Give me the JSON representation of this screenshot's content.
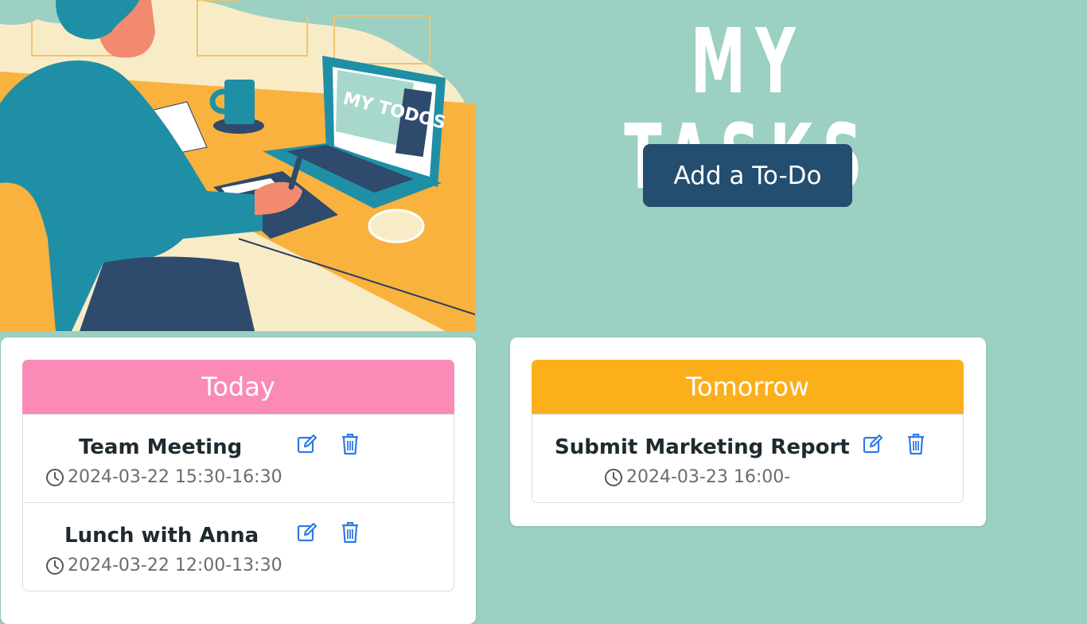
{
  "header": {
    "title": "MY TASKS",
    "add_button_label": "Add a To-Do"
  },
  "illustration": {
    "laptop_screen_text": "MY TODOS"
  },
  "columns": [
    {
      "heading": "Today",
      "color": "#fb8ab6",
      "tasks": [
        {
          "title": "Team Meeting",
          "time": "2024-03-22 15:30-16:30"
        },
        {
          "title": "Lunch with Anna",
          "time": "2024-03-22 12:00-13:30"
        }
      ]
    },
    {
      "heading": "Tomorrow",
      "color": "#fbaf1b",
      "tasks": [
        {
          "title": "Submit Marketing Report",
          "time": "2024-03-23 16:00-"
        }
      ]
    }
  ],
  "icons": {
    "edit": "edit-icon",
    "delete": "trash-icon",
    "time": "clock-icon"
  },
  "colors": {
    "background": "#9bd0c2",
    "button": "#234e70",
    "icon_accent": "#2f7be5"
  }
}
